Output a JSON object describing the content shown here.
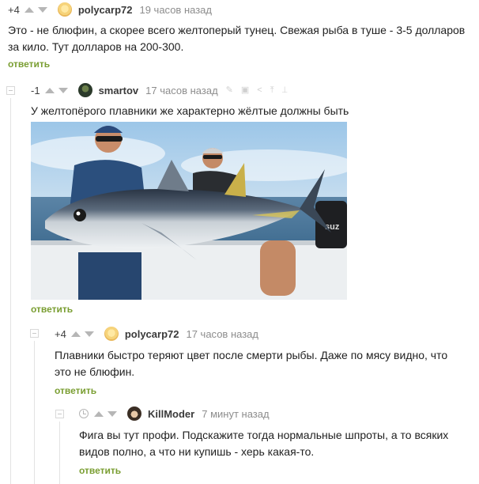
{
  "comments": [
    {
      "rating": "+4",
      "nick": "polycarp72",
      "time": "19 часов назад",
      "text": "Это - не блюфин, а скорее всего желтоперый тунец. Свежая рыба в туше - 3-5 долларов за кило. Тут долларов на 200-300.",
      "reply": "ответить"
    },
    {
      "rating": "-1",
      "nick": "smartov",
      "time": "17 часов назад",
      "text": "У желтопёрого плавники же характерно жёлтые должны быть",
      "reply": "ответить"
    },
    {
      "rating": "+4",
      "nick": "polycarp72",
      "time": "17 часов назад",
      "text": "Плавники быстро теряют цвет после смерти рыбы. Даже по мясу видно, что это не блюфин.",
      "reply": "ответить"
    },
    {
      "nick": "KillModer",
      "time": "7 минут назад",
      "text": "Фига вы тут профи. Подскажите тогда нормальные шпроты, а то всяких видов полно, а что ни купишь - херь какая-то.",
      "reply": "ответить"
    }
  ],
  "icons": {
    "vote_up": "triangle-up-icon",
    "vote_down": "triangle-down-icon",
    "clock": "clock-icon",
    "tools": [
      "edit-icon",
      "save-icon",
      "share-icon",
      "jump-icon",
      "link-icon"
    ]
  },
  "colors": {
    "reply_link": "#7a9e32",
    "nick": "#3a3a3a",
    "time": "#8d8d8d"
  },
  "photo_logo": "suz"
}
